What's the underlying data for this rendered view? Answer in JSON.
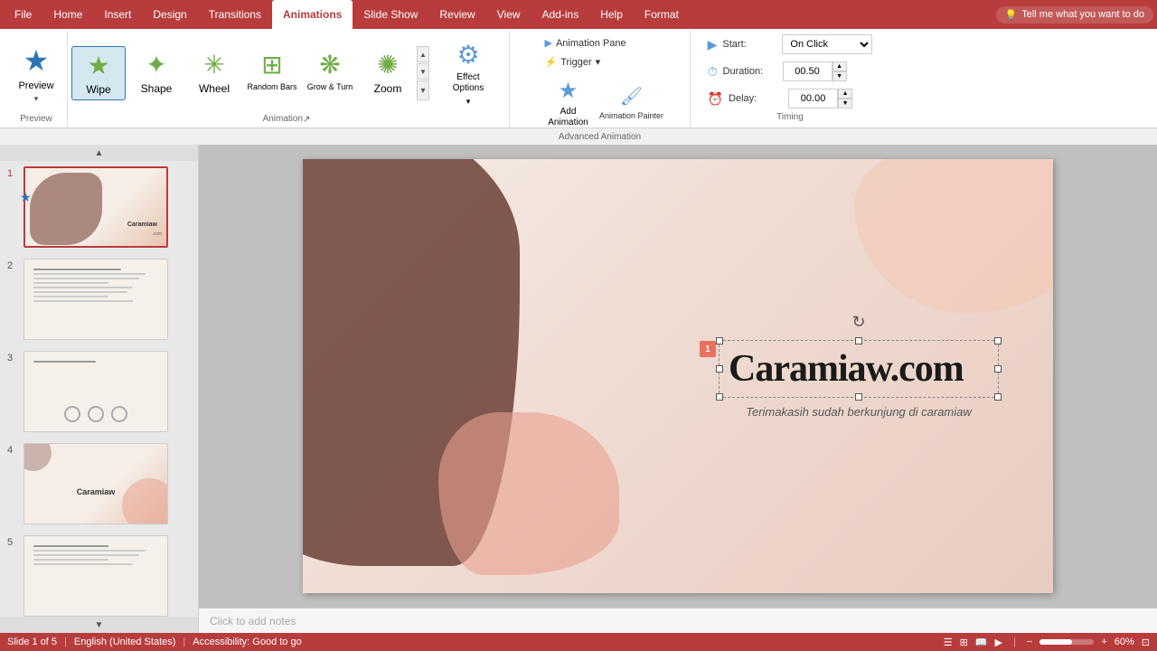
{
  "tabs": [
    {
      "id": "file",
      "label": "File"
    },
    {
      "id": "home",
      "label": "Home"
    },
    {
      "id": "insert",
      "label": "Insert"
    },
    {
      "id": "design",
      "label": "Design"
    },
    {
      "id": "transitions",
      "label": "Transitions"
    },
    {
      "id": "animations",
      "label": "Animations"
    },
    {
      "id": "slideshow",
      "label": "Slide Show"
    },
    {
      "id": "review",
      "label": "Review"
    },
    {
      "id": "view",
      "label": "View"
    },
    {
      "id": "addins",
      "label": "Add-ins"
    },
    {
      "id": "help",
      "label": "Help"
    },
    {
      "id": "format",
      "label": "Format"
    }
  ],
  "tell_me": "Tell me what you want to do",
  "ribbon": {
    "preview": {
      "label": "Preview",
      "arrow": "▾"
    },
    "animations": [
      {
        "id": "wipe",
        "label": "Wipe",
        "selected": true
      },
      {
        "id": "shape",
        "label": "Shape"
      },
      {
        "id": "wheel",
        "label": "Wheel"
      },
      {
        "id": "random_bars",
        "label": "Random Bars"
      },
      {
        "id": "grow_turn",
        "label": "Grow & Turn"
      },
      {
        "id": "zoom",
        "label": "Zoom"
      }
    ],
    "effect_options": {
      "label": "Effect\nOptions"
    },
    "advanced": {
      "animation_pane": "Animation Pane",
      "trigger": "Trigger",
      "trigger_arrow": "▾",
      "add_animation": "Add\nAnimation",
      "animation_painter": "Animation Painter",
      "group_label": "Advanced Animation"
    },
    "timing": {
      "start_label": "Start:",
      "start_value": "On Click",
      "duration_label": "Duration:",
      "duration_value": "00.50",
      "delay_label": "Delay:",
      "delay_value": "00.00",
      "group_label": "Timing"
    },
    "groups": {
      "preview_label": "Preview",
      "animation_label": "Animation",
      "expand_icon": "↗"
    }
  },
  "slides": [
    {
      "num": "1",
      "active": true,
      "has_star": true
    },
    {
      "num": "2",
      "active": false,
      "has_star": false
    },
    {
      "num": "3",
      "active": false,
      "has_star": false
    },
    {
      "num": "4",
      "active": false,
      "has_star": false
    },
    {
      "num": "5",
      "active": false,
      "has_star": false
    }
  ],
  "canvas": {
    "main_text": "Caramiaw.com",
    "sub_text": "Terimakasih sudah berkunjung di caramiaw",
    "anim_badge": "1",
    "rotate_icon": "↻"
  },
  "notes": {
    "placeholder": "Click to add notes"
  },
  "status": {
    "slide_info": "Slide 1 of 5",
    "language": "English (United States)",
    "accessibility": "Accessibility: Good to go",
    "view_icons": [
      "≡",
      "▤",
      "⊞",
      "🔍"
    ],
    "zoom": "60%",
    "zoom_bar": "60"
  }
}
